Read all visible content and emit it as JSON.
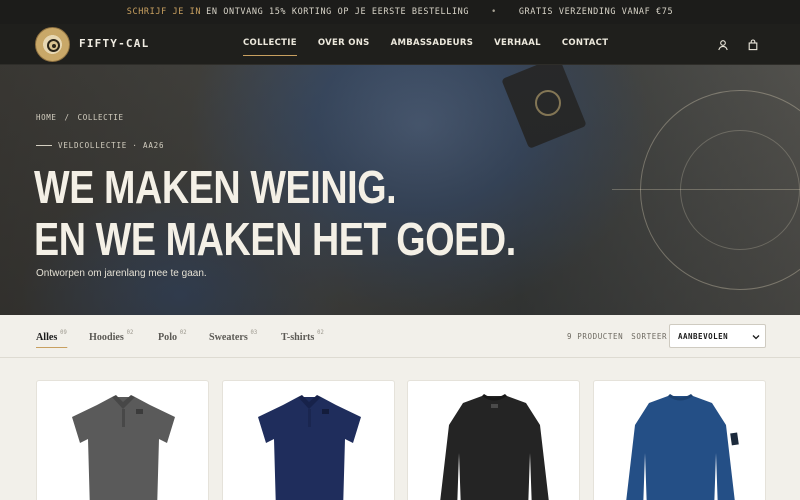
{
  "announcement": {
    "accent": "SCHRIJF JE IN",
    "text": "EN ONTVANG 15% KORTING OP JE EERSTE BESTELLING",
    "separator": "•",
    "shipping": "GRATIS VERZENDING VANAF €75"
  },
  "header": {
    "brand": "FIFTY-CAL",
    "nav": [
      "COLLECTIE",
      "OVER ONS",
      "AMBASSADEURS",
      "VERHAAL",
      "CONTACT"
    ],
    "active_nav": "COLLECTIE",
    "icons": [
      "user-icon",
      "bag-icon"
    ]
  },
  "hero": {
    "breadcrumb": [
      "HOME",
      "/",
      "COLLECTIE"
    ],
    "eyebrow": "VELDCOLLECTIE · AA26",
    "headline_line1": "WE MAKEN WEINIG.",
    "headline_line2": "EN WE MAKEN HET GOED.",
    "subline": "Ontworpen om jarenlang mee te gaan."
  },
  "filters": {
    "tabs": [
      {
        "label": "Alles",
        "count": "09"
      },
      {
        "label": "Hoodies",
        "count": "02"
      },
      {
        "label": "Polo",
        "count": "02"
      },
      {
        "label": "Sweaters",
        "count": "03"
      },
      {
        "label": "T-shirts",
        "count": "02"
      }
    ],
    "active_tab": "Alles",
    "product_count": "9 PRODUCTEN",
    "sort_label": "SORTEER",
    "sort_value": "AANBEVOLEN"
  },
  "products": [
    {
      "type": "polo",
      "color": "#5a5a5a"
    },
    {
      "type": "polo",
      "color": "#1f2d5c"
    },
    {
      "type": "sweater",
      "color": "#242424"
    },
    {
      "type": "sweater",
      "color": "#244f86"
    }
  ],
  "colors": {
    "accent": "#c8a060",
    "dark_bar": "#1c1c1a",
    "page_bg": "#f2f0ea"
  }
}
